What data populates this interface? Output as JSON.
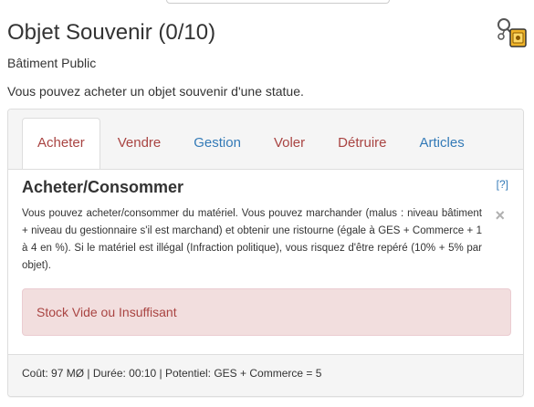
{
  "page": {
    "title": "Objet Souvenir (0/10)",
    "subtitle": "Bâtiment Public",
    "description": "Vous pouvez acheter un objet souvenir d'une statue.",
    "icon": "keychain-icon"
  },
  "tabs": [
    {
      "label": "Acheter",
      "active": true,
      "color": "#a94442"
    },
    {
      "label": "Vendre",
      "active": false,
      "color": "#a94442"
    },
    {
      "label": "Gestion",
      "active": false,
      "color": "#337ab7"
    },
    {
      "label": "Voler",
      "active": false,
      "color": "#a94442"
    },
    {
      "label": "Détruire",
      "active": false,
      "color": "#a94442"
    },
    {
      "label": "Articles",
      "active": false,
      "color": "#337ab7"
    }
  ],
  "section": {
    "title": "Acheter/Consommer",
    "help_label": "[?]",
    "close_glyph": "×",
    "info": "Vous pouvez acheter/consommer du matériel. Vous pouvez marchander (malus : niveau bâtiment + niveau du gestionnaire s'il est marchand) et obtenir une ristourne (égale à GES + Commerce + 1 à 4 en %). Si le matériel est illégal (Infraction politique), vous risquez d'être repéré (10% + 5% par objet).",
    "alert": "Stock Vide ou Insuffisant"
  },
  "footer": {
    "text": "Coût: 97 MØ | Durée: 00:10 | Potentiel: GES + Commerce = 5"
  },
  "colors": {
    "danger_text": "#a94442",
    "link": "#337ab7",
    "alert_bg": "#f2dede"
  }
}
